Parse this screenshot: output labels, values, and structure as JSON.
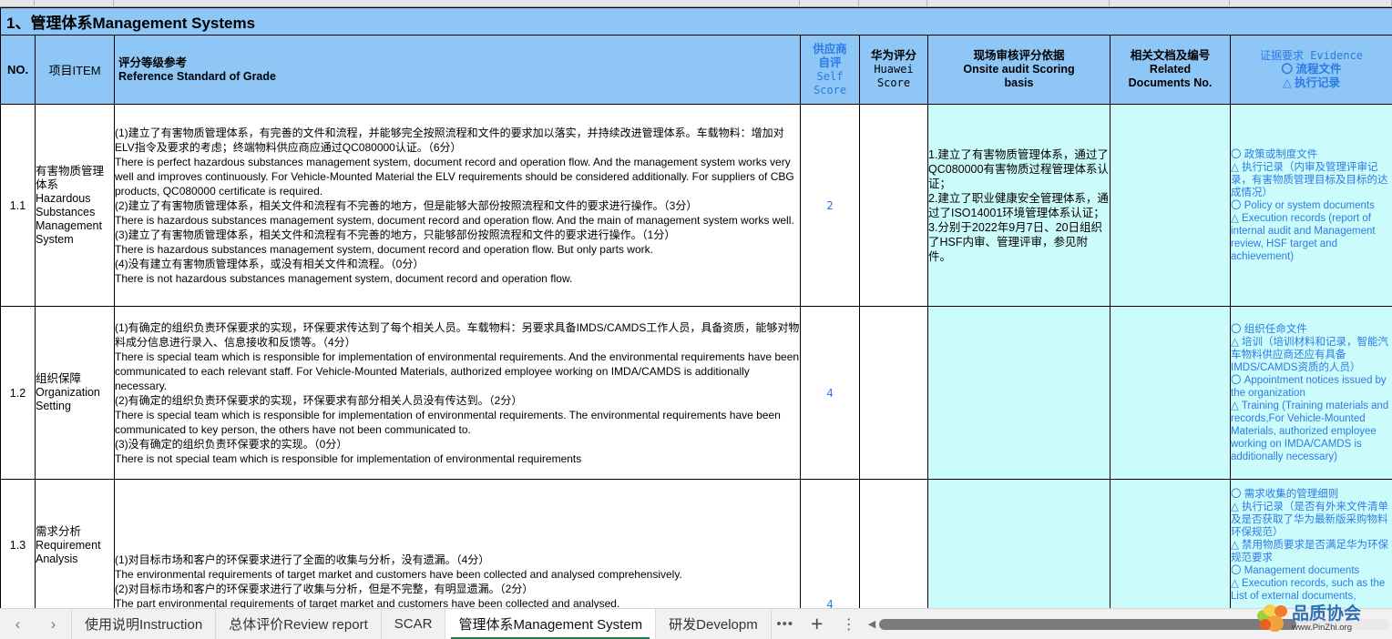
{
  "window": {
    "sheet_title_cn": "1、管理体系",
    "sheet_title_en": "Management Systems"
  },
  "header": {
    "no": "NO.",
    "item": "项目ITEM",
    "reference_cn": "评分等级参考",
    "reference_en": "Reference Standard of Grade",
    "self_score_cn": "供应商\n自评",
    "self_score_en": "Self\nScore",
    "huawei_score_cn": "华为评分",
    "huawei_score_en": "Huawei\nScore",
    "onsite_cn": "现场审核评分依据",
    "onsite_en": "Onsite audit Scoring\nbasis",
    "docs_cn": "相关文档及编号",
    "docs_en": "Related\nDocuments No.",
    "evidence_line1": "证据要求 Evidence",
    "evidence_line2": "〇 流程文件",
    "evidence_line3": "△ 执行记录"
  },
  "rows": [
    {
      "no": "1.1",
      "item_cn": "有害物质管理体系",
      "item_en": "Hazardous Substances Management System",
      "reference": "(1)建立了有害物质管理体系，有完善的文件和流程，并能够完全按照流程和文件的要求加以落实，并持续改进管理体系。车载物料：增加对ELV指令及要求的考虑；终端物料供应商应通过QC080000认证。（6分）\nThere is perfect hazardous substances management system, document record and operation flow. And the management system works very well and improves continuously. For Vehicle-Mounted Material the ELV requirements should be considered additionally. For suppliers of CBG products, QC080000 certificate is required.\n(2)建立了有害物质管理体系，相关文件和流程有不完善的地方，但是能够大部份按照流程和文件的要求进行操作。（3分）\nThere is hazardous substances management system, document record and operation flow. And the main of management system works well.\n(3)建立了有害物质管理体系，相关文件和流程有不完善的地方，只能够部份按照流程和文件的要求进行操作。（1分）\nThere is hazardous substances management system, document record and operation flow. But only parts work.\n(4)没有建立有害物质管理体系，或没有相关文件和流程。（0分）\nThere is not hazardous substances management system, document record and operation flow.",
      "self_score": "2",
      "huawei_score": "",
      "onsite": "1.建立了有害物质管理体系，通过了QC080000有害物质过程管理体系认证；\n2.建立了职业健康安全管理体系，通过了ISO14001环境管理体系认证；\n3.分别于2022年9月7日、20日组织了HSF内审、管理评审，参见附件。",
      "related_docs": "",
      "evidence": "〇 政策或制度文件\n△ 执行记录（内审及管理评审记录，有害物质管理目标及目标的达成情况）\n〇 Policy or system documents\n△ Execution records (report of internal audit and Management review, HSF target and achievement)"
    },
    {
      "no": "1.2",
      "item_cn": "组织保障",
      "item_en": "Organization Setting",
      "reference": "(1)有确定的组织负责环保要求的实现，环保要求传达到了每个相关人员。车载物料：另要求具备IMDS/CAMDS工作人员，具备资质，能够对物料成分信息进行录入、信息接收和反馈等。（4分）\nThere is special team which is responsible for implementation of environmental requirements. And the environmental requirements have been communicated to each relevant staff. For Vehicle-Mounted Materials, authorized employee working on IMDA/CAMDS is additionally necessary.\n(2)有确定的组织负责环保要求的实现，环保要求有部分相关人员没有传达到。（2分）\nThere is special team which is responsible for implementation of environmental requirements. The environmental requirements have been communicated to key person, the others have not been communicated to.\n(3)没有确定的组织负责环保要求的实现。（0分）\nThere is not special team which is responsible for implementation of environmental requirements",
      "self_score": "4",
      "huawei_score": "",
      "onsite": "",
      "related_docs": "",
      "evidence": "〇 组织任命文件\n△ 培训（培训材料和记录，智能汽车物料供应商还应有具备IMDS/CAMDS资质的人员）\n〇 Appointment notices issued by the organization\n△ Training (Training materials and records,For Vehicle-Mounted Materials, authorized employee working on IMDA/CAMDS is additionally necessary)"
    },
    {
      "no": "1.3",
      "item_cn": "需求分析",
      "item_en": "Requirement Analysis",
      "reference": "(1)对目标市场和客户的环保要求进行了全面的收集与分析，没有遗漏。（4分）\nThe environmental requirements of target market and customers have been collected and analysed comprehensively.\n(2)对目标市场和客户的环保要求进行了收集与分析，但是不完整，有明显遗漏。（2分）\nThe part environmental requirements of target market and customers have been collected and analysed.",
      "self_score": "4",
      "huawei_score": "",
      "onsite": "",
      "related_docs": "",
      "evidence": "〇 需求收集的管理细则\n△ 执行记录（是否有外来文件清单及是否获取了华为最新版采购物料环保规范）\n△ 禁用物质要求是否满足华为环保规范要求\n〇 Management documents\n△ Execution records, such as the List of external documents,"
    }
  ],
  "tabbar": {
    "prev": "‹",
    "next": "›",
    "tabs": [
      {
        "label": "使用说明Instruction",
        "active": false
      },
      {
        "label": "总体评价Review report",
        "active": false
      },
      {
        "label": "SCAR",
        "active": false
      },
      {
        "label": "管理体系Management System",
        "active": true
      },
      {
        "label": "研发Developm",
        "active": false
      }
    ],
    "more_tabs": "•••",
    "add_sheet": "+",
    "sheet_menu": "⋮",
    "scroll_left": "◀"
  },
  "watermark": {
    "name_cn": "品质协会",
    "url": "www.PinZhi.org"
  },
  "colors": {
    "header_blue": "#8ec6f5",
    "accent_blue": "#2c7be5",
    "cyan_cell": "#ccfbfb",
    "active_tab_underline": "#1f7a4d"
  }
}
